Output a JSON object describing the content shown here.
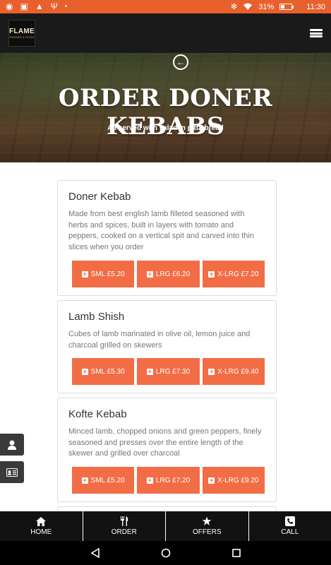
{
  "status_bar": {
    "battery": "31%",
    "battery_level": 0.31,
    "time": "11:30",
    "icons": [
      "shield-icon",
      "image-icon",
      "warning-icon",
      "usb-icon",
      "dot-icon",
      "bluetooth-icon",
      "wifi-icon",
      "battery-icon"
    ]
  },
  "header": {
    "logo_text": "FLAME",
    "logo_subtext": "KEBABS & PIZZA",
    "menu_icon": "hamburger-icon"
  },
  "hero": {
    "title": "ORDER DONER KEBABS",
    "subtitle": "All served with salad in pitta bread"
  },
  "menu_items": [
    {
      "name": "Doner Kebab",
      "description": "Made from best english lamb filleted seasoned with herbs and spices, built in layers with tomato and peppers, cooked on a vertical spit and carved into thin slices when you order",
      "options": [
        "SML £5.20",
        "LRG £6.20",
        "X-LRG £7.20"
      ]
    },
    {
      "name": "Lamb Shish",
      "description": "Cubes of lamb marinated in olive oil, lemon juice and charcoal grilled on skewers",
      "options": [
        "SML £5.30",
        "LRG £7.30",
        "X-LRG £9.40"
      ]
    },
    {
      "name": "Kofte Kebab",
      "description": "Minced lamb, chopped onions and green peppers, finely seasoned and presses over the entire length of the skewer and grilled over charcoal",
      "options": [
        "SML £5.20",
        "LRG £7.20",
        "X-LRG £9.20"
      ]
    }
  ],
  "bottom_nav": [
    {
      "label": "HOME",
      "icon": "home-icon"
    },
    {
      "label": "ORDER",
      "icon": "cutlery-icon"
    },
    {
      "label": "OFFERS",
      "icon": "star-icon"
    },
    {
      "label": "CALL",
      "icon": "phone-icon"
    }
  ],
  "colors": {
    "accent": "#f26d46",
    "status_bar": "#e8612c",
    "header_bg": "#1a1a1a",
    "nav_bg": "#111111"
  }
}
